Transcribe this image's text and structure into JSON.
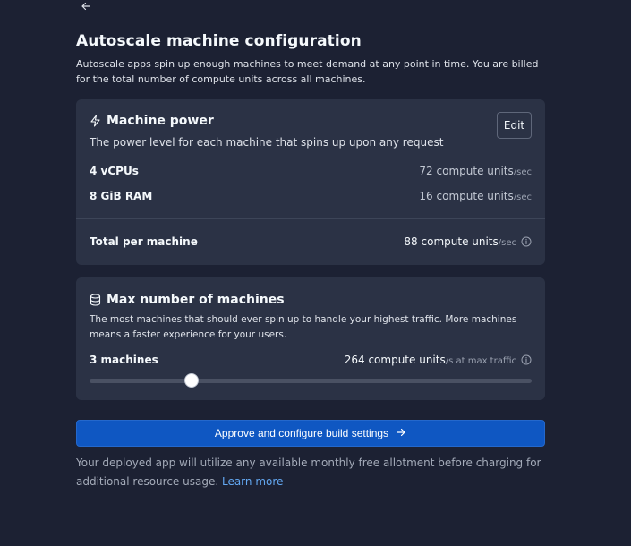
{
  "page": {
    "title": "Autoscale machine configuration",
    "description": "Autoscale apps spin up enough machines to meet demand at any point in time. You are billed for the total number of compute units across all machines."
  },
  "machine_power": {
    "icon": "lightning-icon",
    "title": "Machine power",
    "edit_label": "Edit",
    "subtitle": "The power level for each machine that spins up upon any request",
    "rows": [
      {
        "label": "4 vCPUs",
        "value": "72 compute units",
        "unit": "/sec"
      },
      {
        "label": "8 GiB RAM",
        "value": "16 compute units",
        "unit": "/sec"
      }
    ],
    "total": {
      "label": "Total per machine",
      "value": "88 compute units",
      "unit": "/sec"
    }
  },
  "max_machines": {
    "icon": "database-icon",
    "title": "Max number of machines",
    "description": "The most machines that should ever spin up to handle your highest traffic. More machines means a faster experience for your users.",
    "count_label": "3 machines",
    "value": "264 compute units",
    "unit": "/s at max traffic",
    "slider": {
      "value": 3
    }
  },
  "primary_button": {
    "label": "Approve and configure build settings"
  },
  "footnote": {
    "text": "Your deployed app will utilize any available monthly free allotment before charging for additional resource usage. ",
    "link": "Learn more"
  },
  "colors": {
    "background": "#1c2133",
    "card": "#2b3245",
    "primary": "#0f57c2",
    "link": "#63a8f2"
  }
}
